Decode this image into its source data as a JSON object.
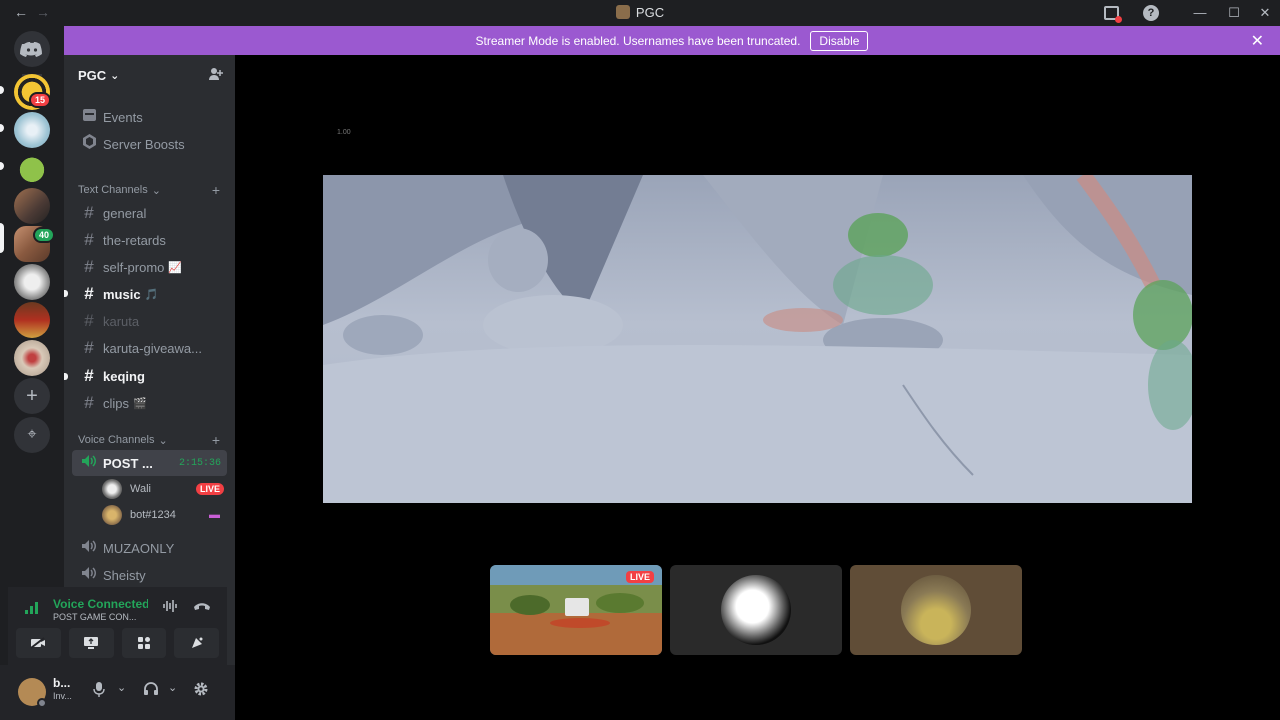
{
  "titlebar": {
    "back": "←",
    "forward": "→",
    "title": "PGC",
    "minimize": "—",
    "maximize": "☐",
    "close": "✕",
    "help": "?"
  },
  "banner": {
    "text": "Streamer Mode is enabled. Usernames have been truncated.",
    "button": "Disable",
    "close": "✕"
  },
  "servers": {
    "badges": [
      "15",
      "40"
    ],
    "add": "+",
    "explore": "⌖"
  },
  "guild": {
    "name": "PGC",
    "chevron": "⌄"
  },
  "top_items": [
    {
      "label": "Events",
      "icon": "calendar-icon"
    },
    {
      "label": "Server Boosts",
      "icon": "boost-icon"
    }
  ],
  "text_category": "Text Channels",
  "text_channels": [
    {
      "label": "general",
      "emoji": ""
    },
    {
      "label": "the-retards",
      "emoji": ""
    },
    {
      "label": "self-promo",
      "emoji": "📈"
    },
    {
      "label": "music",
      "emoji": "🎵"
    },
    {
      "label": "karuta",
      "emoji": ""
    },
    {
      "label": "karuta-giveawa...",
      "emoji": ""
    },
    {
      "label": "keqing",
      "emoji": ""
    },
    {
      "label": "clips",
      "emoji": "🎬"
    }
  ],
  "voice_category": "Voice Channels",
  "voice_channels": [
    {
      "label": "POST ...",
      "timer": "2:15:36"
    },
    {
      "label": "MUZAONLY"
    },
    {
      "label": "Sheisty"
    }
  ],
  "voice_users": [
    {
      "name": "Wali",
      "tag": "LIVE"
    },
    {
      "name": "bot#1234",
      "tag": ""
    }
  ],
  "rtc": {
    "status": "Voice Connected",
    "channel": "POST GAME CON..."
  },
  "user": {
    "name": "b...",
    "sub": "Inv..."
  },
  "stage": {
    "zoom": "1.00",
    "live_label": "LIVE"
  },
  "colors": {
    "banner": "#9b59d0",
    "connected": "#23a55a",
    "live": "#f23f43"
  }
}
